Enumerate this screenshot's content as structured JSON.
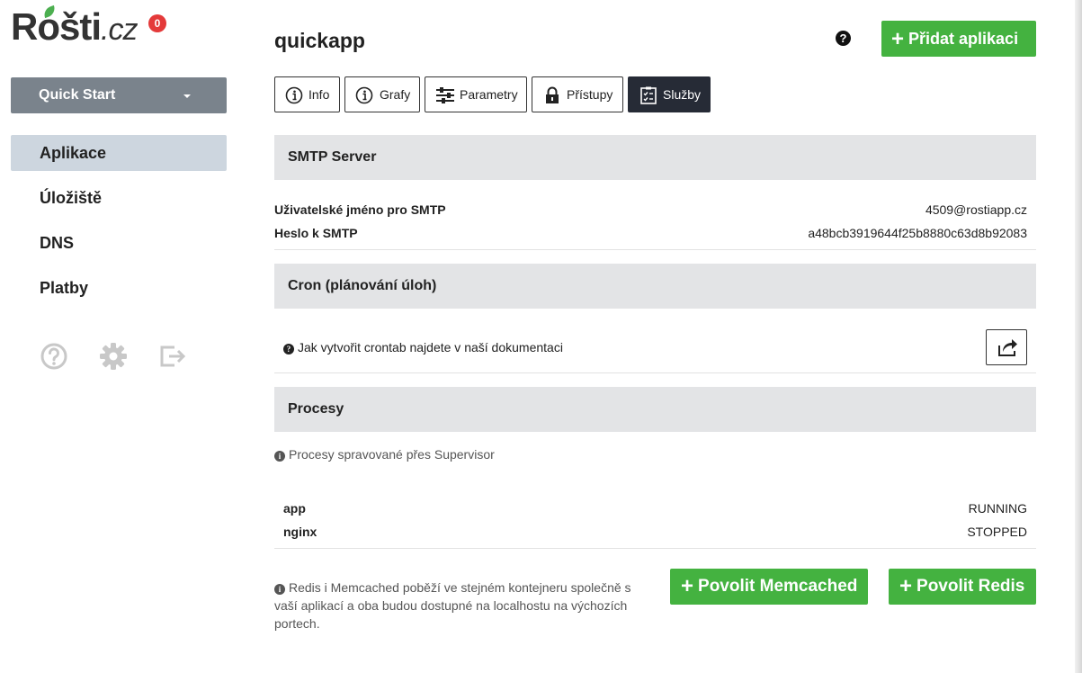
{
  "brand": {
    "logo_text": "Rošti",
    "logo_suffix": ".cz",
    "badge_count": "0"
  },
  "sidebar": {
    "quick_start": "Quick Start",
    "items": [
      {
        "label": "Aplikace",
        "active": true
      },
      {
        "label": "Úložiště",
        "active": false
      },
      {
        "label": "DNS",
        "active": false
      },
      {
        "label": "Platby",
        "active": false
      }
    ],
    "icons": [
      "help-circle-icon",
      "gear-icon",
      "logout-icon"
    ]
  },
  "header": {
    "title": "quickapp",
    "help_icon": "?",
    "add_app_label": "Přidat aplikaci"
  },
  "tabs": [
    {
      "label": "Info",
      "icon": "info-icon",
      "active": false
    },
    {
      "label": "Grafy",
      "icon": "info-icon",
      "active": false
    },
    {
      "label": "Parametry",
      "icon": "sliders-icon",
      "active": false
    },
    {
      "label": "Přístupy",
      "icon": "lock-icon",
      "active": false
    },
    {
      "label": "Služby",
      "icon": "checklist-icon",
      "active": true
    }
  ],
  "smtp": {
    "title": "SMTP Server",
    "rows": [
      {
        "key": "Uživatelské jméno pro SMTP",
        "value": "4509@rostiapp.cz"
      },
      {
        "key": "Heslo k SMTP",
        "value": "a48bcb3919644f25b8880c63d8b92083"
      }
    ]
  },
  "cron": {
    "title": "Cron (plánování úloh)",
    "info": "Jak vytvořit crontab najdete v naší dokumentaci"
  },
  "processes": {
    "title": "Procesy",
    "info": "Procesy spravované přes Supervisor",
    "rows": [
      {
        "name": "app",
        "status": "RUNNING"
      },
      {
        "name": "nginx",
        "status": "STOPPED"
      }
    ]
  },
  "services": {
    "note": "Redis i Memcached poběží ve stejném kontejneru společně s vaší aplikací a oba budou dostupné na localhostu na výchozích portech.",
    "memcached_label": "Povolit Memcached",
    "redis_label": "Povolit Redis"
  },
  "colors": {
    "accent_green": "#44b240",
    "dark_tab": "#262b36",
    "badge_red": "#e43a3a",
    "active_nav": "#cdd6df"
  }
}
